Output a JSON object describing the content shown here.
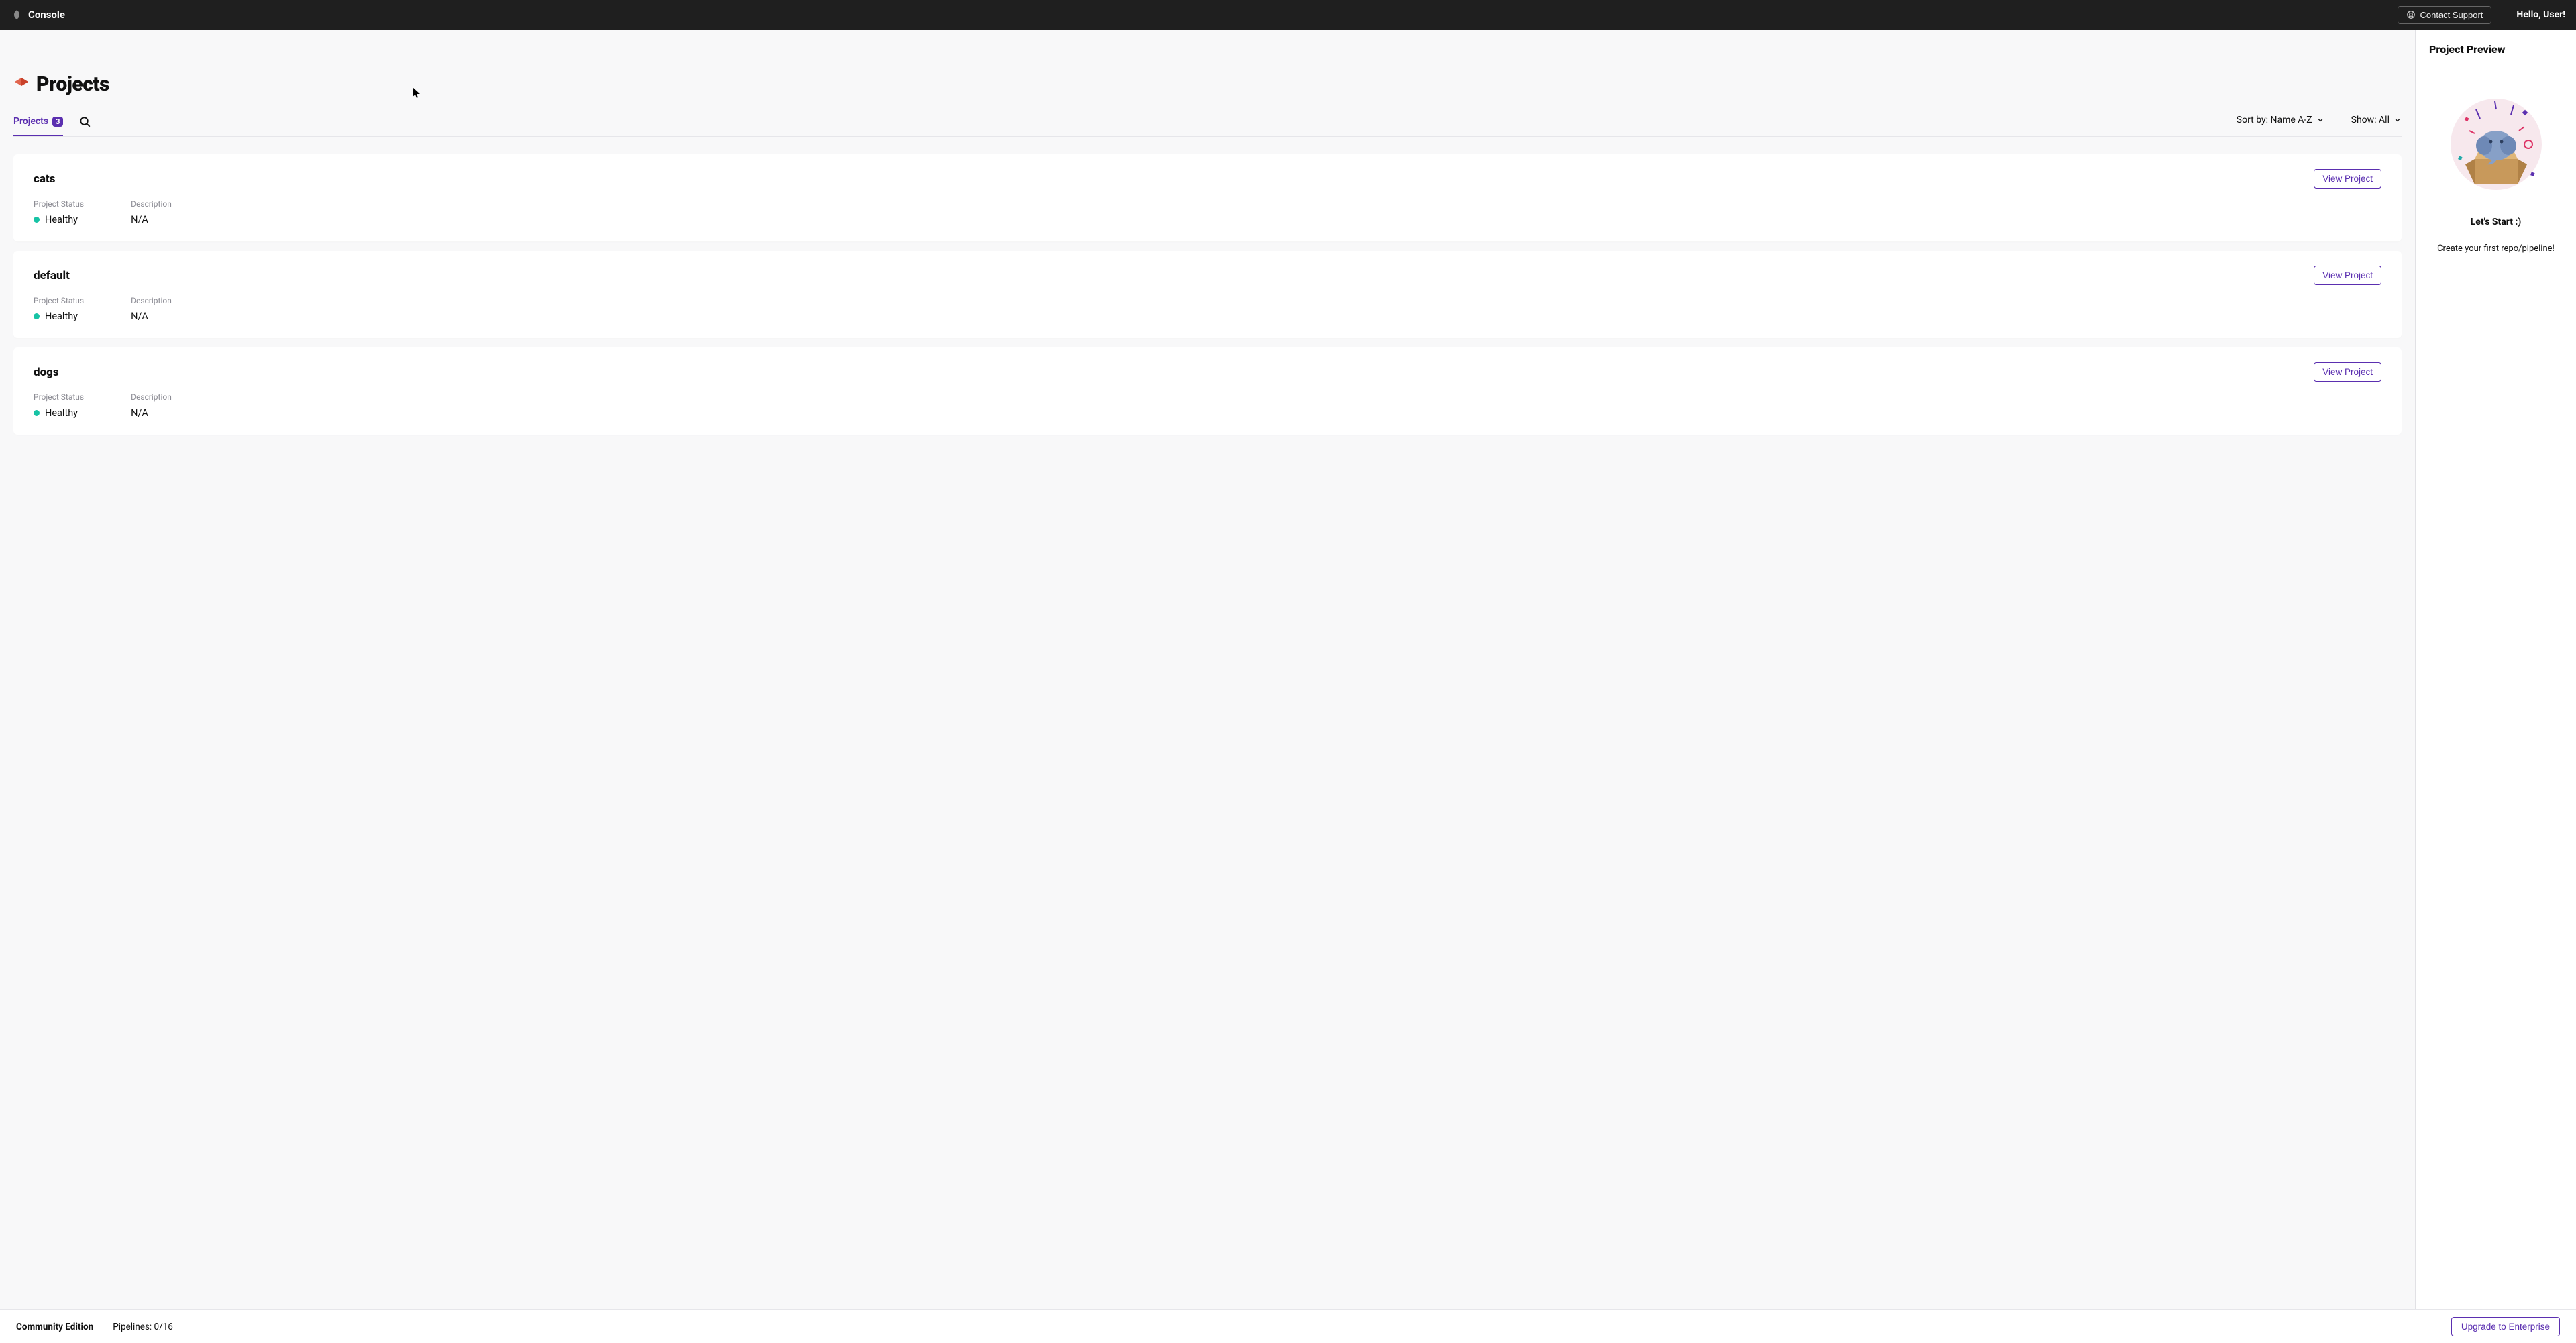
{
  "header": {
    "brand": "Console",
    "contact_support": "Contact Support",
    "greeting": "Hello, User!"
  },
  "page": {
    "title": "Projects"
  },
  "tabs": {
    "projects_label": "Projects",
    "projects_count": "3"
  },
  "sort": {
    "sort_label": "Sort by: Name A-Z",
    "show_label": "Show: All"
  },
  "status_labels": {
    "project_status": "Project Status",
    "description": "Description"
  },
  "buttons": {
    "view_project": "View  Project"
  },
  "projects": [
    {
      "name": "cats",
      "status": "Healthy",
      "description": "N/A"
    },
    {
      "name": "default",
      "status": "Healthy",
      "description": "N/A"
    },
    {
      "name": "dogs",
      "status": "Healthy",
      "description": "N/A"
    }
  ],
  "preview": {
    "title": "Project Preview",
    "start": "Let's Start :)",
    "hint": "Create your first repo/pipeline!"
  },
  "footer": {
    "edition": "Community Edition",
    "pipelines": "Pipelines: 0/16",
    "upgrade": "Upgrade to Enterprise"
  },
  "colors": {
    "accent": "#5b2fb0",
    "healthy": "#17c3a5"
  }
}
